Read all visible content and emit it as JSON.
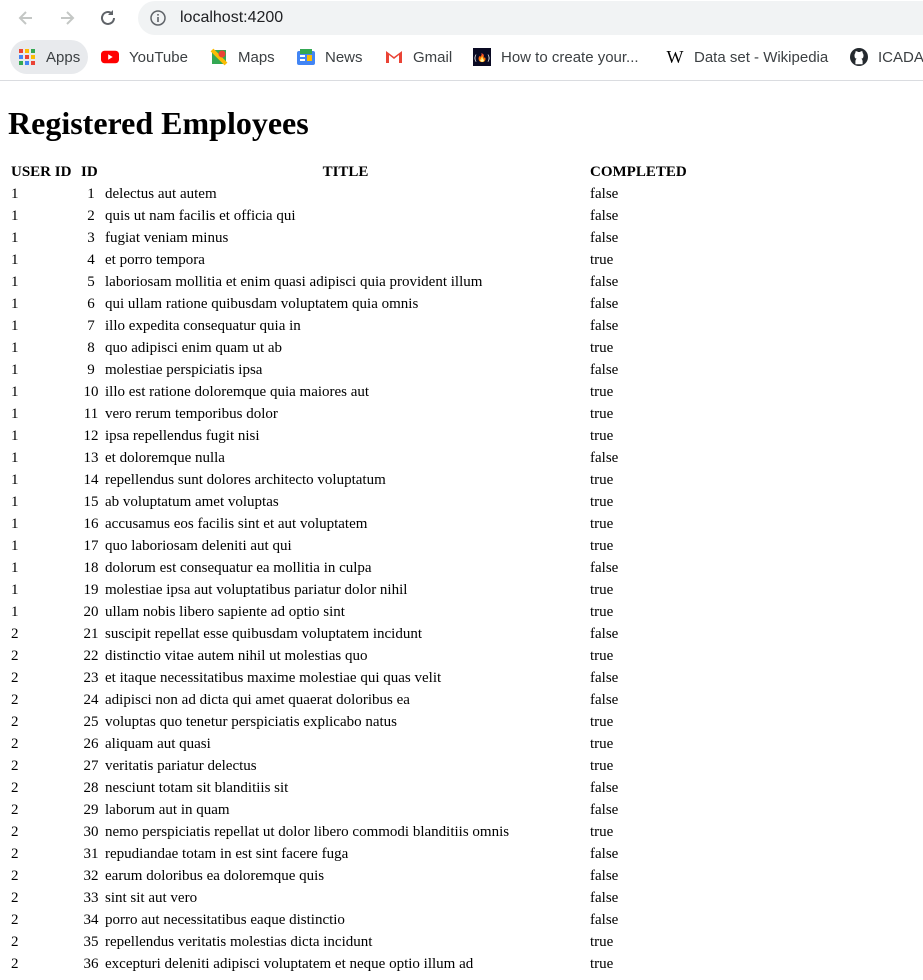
{
  "browser": {
    "url": "localhost:4200",
    "bookmarks": [
      {
        "label": "Apps",
        "icon": "apps-grid-icon"
      },
      {
        "label": "YouTube",
        "icon": "youtube-icon"
      },
      {
        "label": "Maps",
        "icon": "maps-icon"
      },
      {
        "label": "News",
        "icon": "news-icon"
      },
      {
        "label": "Gmail",
        "icon": "gmail-icon"
      },
      {
        "label": "How to create your...",
        "icon": "freecodecamp-icon"
      },
      {
        "label": "Data set - Wikipedia",
        "icon": "wikipedia-icon"
      },
      {
        "label": "ICADA",
        "icon": "github-icon"
      }
    ]
  },
  "page": {
    "title": "Registered Employees",
    "columns": [
      "USER ID",
      "ID",
      "TITLE",
      "COMPLETED"
    ],
    "rows": [
      [
        "1",
        "1",
        "delectus aut autem",
        "false"
      ],
      [
        "1",
        "2",
        "quis ut nam facilis et officia qui",
        "false"
      ],
      [
        "1",
        "3",
        "fugiat veniam minus",
        "false"
      ],
      [
        "1",
        "4",
        "et porro tempora",
        "true"
      ],
      [
        "1",
        "5",
        "laboriosam mollitia et enim quasi adipisci quia provident illum",
        "false"
      ],
      [
        "1",
        "6",
        "qui ullam ratione quibusdam voluptatem quia omnis",
        "false"
      ],
      [
        "1",
        "7",
        "illo expedita consequatur quia in",
        "false"
      ],
      [
        "1",
        "8",
        "quo adipisci enim quam ut ab",
        "true"
      ],
      [
        "1",
        "9",
        "molestiae perspiciatis ipsa",
        "false"
      ],
      [
        "1",
        "10",
        "illo est ratione doloremque quia maiores aut",
        "true"
      ],
      [
        "1",
        "11",
        "vero rerum temporibus dolor",
        "true"
      ],
      [
        "1",
        "12",
        "ipsa repellendus fugit nisi",
        "true"
      ],
      [
        "1",
        "13",
        "et doloremque nulla",
        "false"
      ],
      [
        "1",
        "14",
        "repellendus sunt dolores architecto voluptatum",
        "true"
      ],
      [
        "1",
        "15",
        "ab voluptatum amet voluptas",
        "true"
      ],
      [
        "1",
        "16",
        "accusamus eos facilis sint et aut voluptatem",
        "true"
      ],
      [
        "1",
        "17",
        "quo laboriosam deleniti aut qui",
        "true"
      ],
      [
        "1",
        "18",
        "dolorum est consequatur ea mollitia in culpa",
        "false"
      ],
      [
        "1",
        "19",
        "molestiae ipsa aut voluptatibus pariatur dolor nihil",
        "true"
      ],
      [
        "1",
        "20",
        "ullam nobis libero sapiente ad optio sint",
        "true"
      ],
      [
        "2",
        "21",
        "suscipit repellat esse quibusdam voluptatem incidunt",
        "false"
      ],
      [
        "2",
        "22",
        "distinctio vitae autem nihil ut molestias quo",
        "true"
      ],
      [
        "2",
        "23",
        "et itaque necessitatibus maxime molestiae qui quas velit",
        "false"
      ],
      [
        "2",
        "24",
        "adipisci non ad dicta qui amet quaerat doloribus ea",
        "false"
      ],
      [
        "2",
        "25",
        "voluptas quo tenetur perspiciatis explicabo natus",
        "true"
      ],
      [
        "2",
        "26",
        "aliquam aut quasi",
        "true"
      ],
      [
        "2",
        "27",
        "veritatis pariatur delectus",
        "true"
      ],
      [
        "2",
        "28",
        "nesciunt totam sit blanditiis sit",
        "false"
      ],
      [
        "2",
        "29",
        "laborum aut in quam",
        "false"
      ],
      [
        "2",
        "30",
        "nemo perspiciatis repellat ut dolor libero commodi blanditiis omnis",
        "true"
      ],
      [
        "2",
        "31",
        "repudiandae totam in est sint facere fuga",
        "false"
      ],
      [
        "2",
        "32",
        "earum doloribus ea doloremque quis",
        "false"
      ],
      [
        "2",
        "33",
        "sint sit aut vero",
        "false"
      ],
      [
        "2",
        "34",
        "porro aut necessitatibus eaque distinctio",
        "false"
      ],
      [
        "2",
        "35",
        "repellendus veritatis molestias dicta incidunt",
        "true"
      ],
      [
        "2",
        "36",
        "excepturi deleniti adipisci voluptatem et neque optio illum ad",
        "true"
      ]
    ]
  }
}
